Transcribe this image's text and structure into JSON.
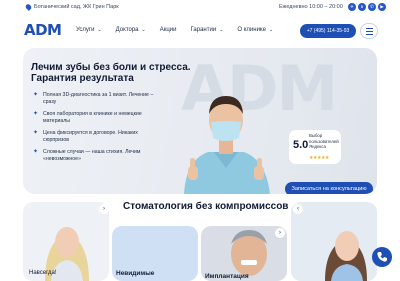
{
  "header": {
    "address": "Ботанический сад, ЖК Грин Парк",
    "hours": "Ежедневно 10:00 – 20:00",
    "socials": [
      "telegram-icon",
      "vk-icon",
      "whatsapp-icon",
      "rutube-icon"
    ]
  },
  "nav": {
    "logo": "ADM",
    "items": [
      {
        "label": "Услуги"
      },
      {
        "label": "Доктора"
      },
      {
        "label": "Акции"
      },
      {
        "label": "Гарантии"
      },
      {
        "label": "О клинике"
      }
    ],
    "phone": "+7 (495) 114-35-93"
  },
  "hero": {
    "background_text": "ADM",
    "title": "Лечим зубы без боли и стресса. Гарантия результата",
    "bullets": [
      "Полная 3D-диагностика за 1 визит. Лечение – сразу",
      "Своя лаборатория в клинике и немецкие материалы",
      "Цена фиксируется в договоре. Никаких сюрпризов",
      "Сложные случаи — наша стихия. Лечим «невозможное»"
    ],
    "rating": {
      "value": "5.0",
      "text": "Выбор пользователей Яндекса",
      "stars": "★★★★★"
    },
    "cta": "Записаться на консультацию"
  },
  "section": {
    "title": "Стоматология без компромиссов",
    "cards": [
      {
        "label": "Навсегда!"
      },
      {
        "label": "Невидимые"
      },
      {
        "label": "Имплантация"
      }
    ]
  },
  "colors": {
    "accent": "#1f4fb5",
    "star": "#f2b01e"
  }
}
